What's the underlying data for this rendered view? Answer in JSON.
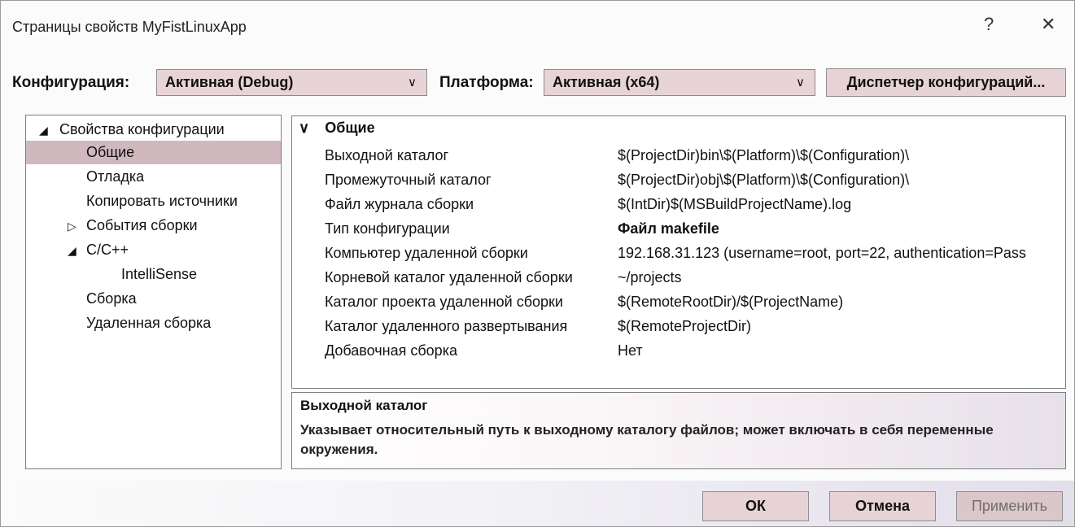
{
  "window": {
    "title": "Страницы свойств MyFistLinuxApp",
    "help_glyph": "?",
    "close_glyph": "✕"
  },
  "toolbar": {
    "config_label": "Конфигурация:",
    "config_value": "Активная (Debug)",
    "platform_label": "Платформа:",
    "platform_value": "Активная (x64)",
    "config_manager_label": "Диспетчер конфигураций..."
  },
  "tree": {
    "root": "Свойства конфигурации",
    "items": [
      {
        "label": "Общие",
        "selected": true
      },
      {
        "label": "Отладка"
      },
      {
        "label": "Копировать источники"
      },
      {
        "label": "События сборки",
        "expander": "▷"
      },
      {
        "label": "C/C++",
        "expander": "◢"
      },
      {
        "label": "IntelliSense"
      },
      {
        "label": "Сборка"
      },
      {
        "label": "Удаленная сборка"
      }
    ],
    "root_expander": "◢"
  },
  "grid": {
    "category": "Общие",
    "category_chevron": "∨",
    "rows": [
      {
        "name": "Выходной каталог",
        "value": "$(ProjectDir)bin\\$(Platform)\\$(Configuration)\\"
      },
      {
        "name": "Промежуточный каталог",
        "value": "$(ProjectDir)obj\\$(Platform)\\$(Configuration)\\"
      },
      {
        "name": "Файл журнала сборки",
        "value": "$(IntDir)$(MSBuildProjectName).log"
      },
      {
        "name": "Тип конфигурации",
        "value": "Файл makefile",
        "bold": true
      },
      {
        "name": "Компьютер удаленной сборки",
        "value": "192.168.31.123 (username=root, port=22, authentication=Pass"
      },
      {
        "name": "Корневой каталог удаленной сборки",
        "value": "~/projects"
      },
      {
        "name": "Каталог проекта удаленной сборки",
        "value": "$(RemoteRootDir)/$(ProjectName)"
      },
      {
        "name": "Каталог удаленного развертывания",
        "value": "$(RemoteProjectDir)"
      },
      {
        "name": "Добавочная сборка",
        "value": "Нет"
      }
    ]
  },
  "description": {
    "heading": "Выходной каталог",
    "text": "Указывает относительный путь к выходному каталогу файлов; может включать в себя переменные окружения."
  },
  "buttons": {
    "ok": "ОК",
    "cancel": "Отмена",
    "apply": "Применить"
  },
  "colors": {
    "accent_combo": "#e8d4d7",
    "selection": "#cfb9bf"
  }
}
